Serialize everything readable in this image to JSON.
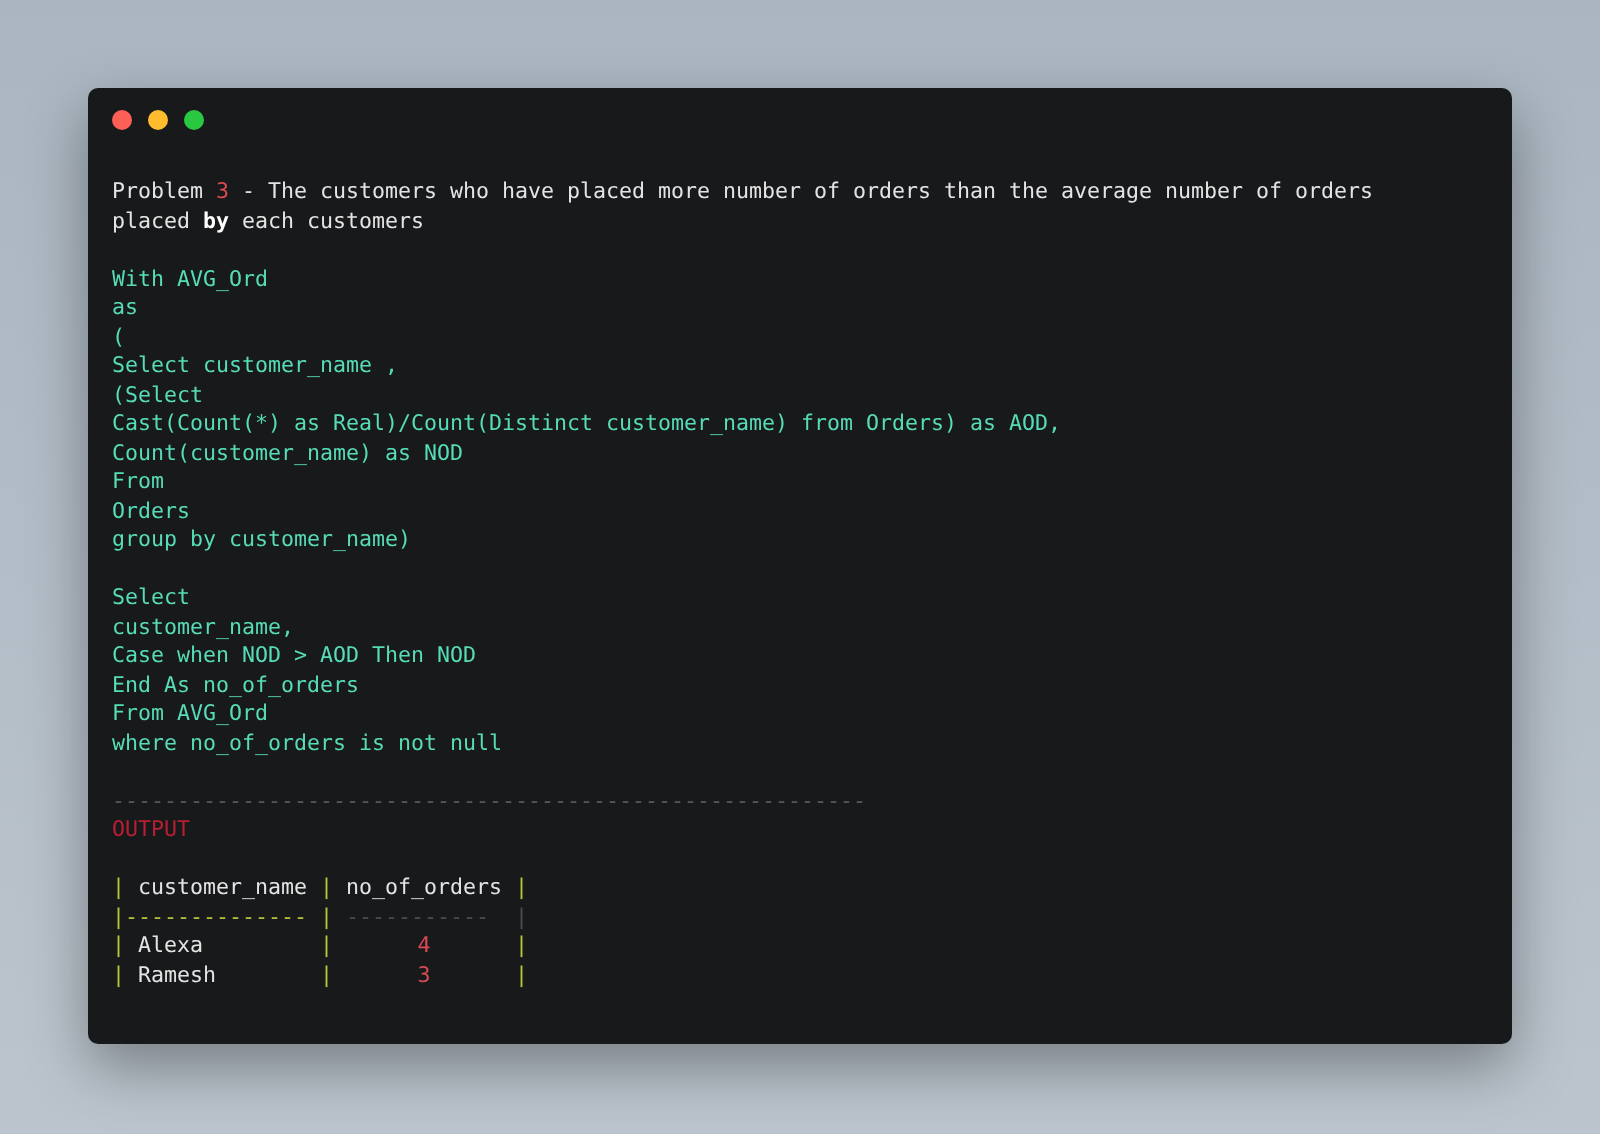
{
  "window": {
    "controls": [
      {
        "kind": "close"
      },
      {
        "kind": "minimize"
      },
      {
        "kind": "maximize"
      }
    ]
  },
  "title": {
    "prefix": "Problem ",
    "number": "3",
    "rest": " - The customers who have placed more number of orders than the average number of orders\nplaced **by** each customers"
  },
  "code_blocks": [
    [
      "With AVG_Ord",
      "as",
      "(",
      "Select customer_name ,",
      "(Select",
      "Cast(Count(*) as Real)/Count(Distinct customer_name) from Orders) as AOD,",
      "Count(customer_name) as NOD",
      "From",
      "Orders",
      "group by customer_name)"
    ],
    [
      "Select",
      "customer_name,",
      "Case when NOD > AOD Then NOD",
      "End As no_of_orders",
      "From AVG_Ord",
      "where no_of_orders is not null"
    ]
  ],
  "separator": "----------------------------------------------------------",
  "output_label": "OUTPUT",
  "table": {
    "columns": [
      {
        "header": "customer_name",
        "rule": "--------------"
      },
      {
        "header": "no_of_orders",
        "rule": "-----------"
      }
    ],
    "pipes": {
      "header": [
        "|",
        "|",
        "|"
      ],
      "rule": [
        "|",
        "|",
        "|"
      ],
      "rows": [
        [
          "|",
          "|",
          "|"
        ],
        [
          "|",
          "|",
          "|"
        ]
      ]
    },
    "rows": [
      {
        "cells": [
          "Alexa",
          "4"
        ]
      },
      {
        "cells": [
          "Ramesh",
          "3"
        ]
      }
    ]
  }
}
